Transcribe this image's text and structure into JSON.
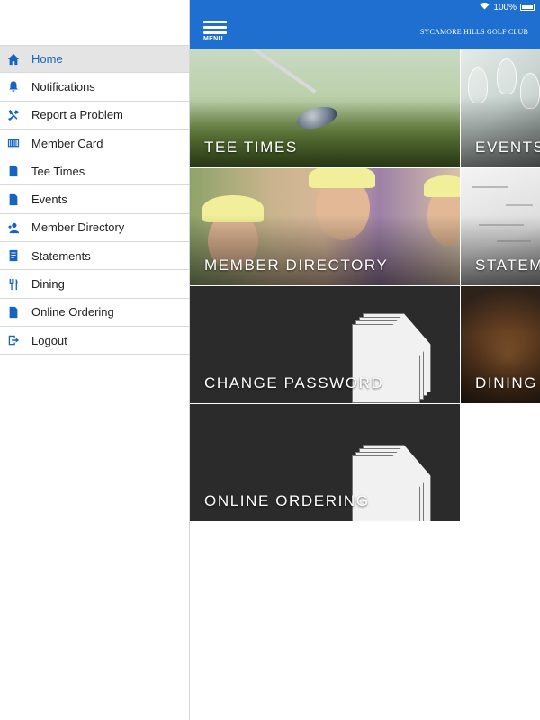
{
  "status": {
    "battery": "100%"
  },
  "header": {
    "menu_label": "MENU",
    "club_name": "SYCAMORE HILLS GOLF CLUB"
  },
  "sidebar": {
    "items": [
      {
        "label": "Home",
        "icon": "home-icon"
      },
      {
        "label": "Notifications",
        "icon": "bell-icon"
      },
      {
        "label": "Report a Problem",
        "icon": "tools-icon"
      },
      {
        "label": "Member Card",
        "icon": "barcode-icon"
      },
      {
        "label": "Tee Times",
        "icon": "document-icon"
      },
      {
        "label": "Events",
        "icon": "document-icon"
      },
      {
        "label": "Member Directory",
        "icon": "members-icon"
      },
      {
        "label": "Statements",
        "icon": "statement-icon"
      },
      {
        "label": "Dining",
        "icon": "utensils-icon"
      },
      {
        "label": "Online Ordering",
        "icon": "document-icon"
      },
      {
        "label": "Logout",
        "icon": "logout-icon"
      }
    ],
    "active": "Home"
  },
  "tiles": {
    "tee_times": "TEE TIMES",
    "events": "EVENTS",
    "member_directory": "MEMBER DIRECTORY",
    "statements": "STATEMENTS",
    "change_password": "CHANGE PASSWORD",
    "dining": "DINING",
    "online_ordering": "ONLINE ORDERING"
  },
  "colors": {
    "accent": "#1e6fd0",
    "icon": "#1565c0",
    "tile_dark": "#2b2b2b"
  }
}
